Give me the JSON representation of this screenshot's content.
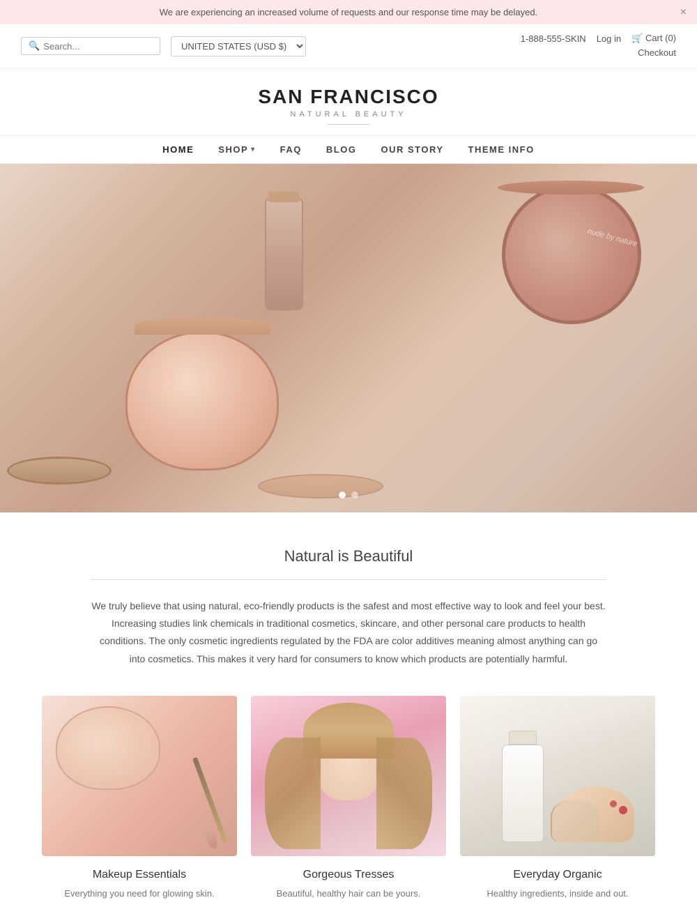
{
  "announcement": {
    "text": "We are experiencing an increased volume of requests and our response time may be delayed.",
    "close_label": "×"
  },
  "utility_bar": {
    "search_placeholder": "Search...",
    "country_selector": "UNITED STATES (USD $)",
    "phone": "1-888-555-SKIN",
    "login_label": "Log in",
    "cart_label": "Cart (0)",
    "checkout_label": "Checkout"
  },
  "logo": {
    "brand_name": "SAN FRANCISCO",
    "brand_sub": "NATURAL BEAUTY"
  },
  "nav": {
    "items": [
      {
        "label": "HOME",
        "active": true,
        "has_dropdown": false
      },
      {
        "label": "SHOP",
        "active": false,
        "has_dropdown": true
      },
      {
        "label": "FAQ",
        "active": false,
        "has_dropdown": false
      },
      {
        "label": "BLOG",
        "active": false,
        "has_dropdown": false
      },
      {
        "label": "OUR STORY",
        "active": false,
        "has_dropdown": false
      },
      {
        "label": "THEME INFO",
        "active": false,
        "has_dropdown": false
      }
    ]
  },
  "about": {
    "heading": "Natural is Beautiful",
    "body": "We truly believe that using natural, eco-friendly products is the safest and most effective way to look and feel your best. Increasing studies link chemicals in traditional cosmetics, skincare, and other personal care products to health conditions. The only cosmetic ingredients regulated by the FDA are color additives meaning almost anything can go into cosmetics. This makes it very hard for consumers to know which products are potentially harmful."
  },
  "products": [
    {
      "title": "Makeup Essentials",
      "description": "Everything you need for glowing skin.",
      "image_type": "makeup"
    },
    {
      "title": "Gorgeous Tresses",
      "description": "Beautiful, healthy hair can be yours.",
      "image_type": "hair"
    },
    {
      "title": "Everyday Organic",
      "description": "Healthy ingredients, inside and out.",
      "image_type": "organic"
    }
  ],
  "slider_dots": [
    {
      "active": true
    },
    {
      "active": false
    }
  ]
}
